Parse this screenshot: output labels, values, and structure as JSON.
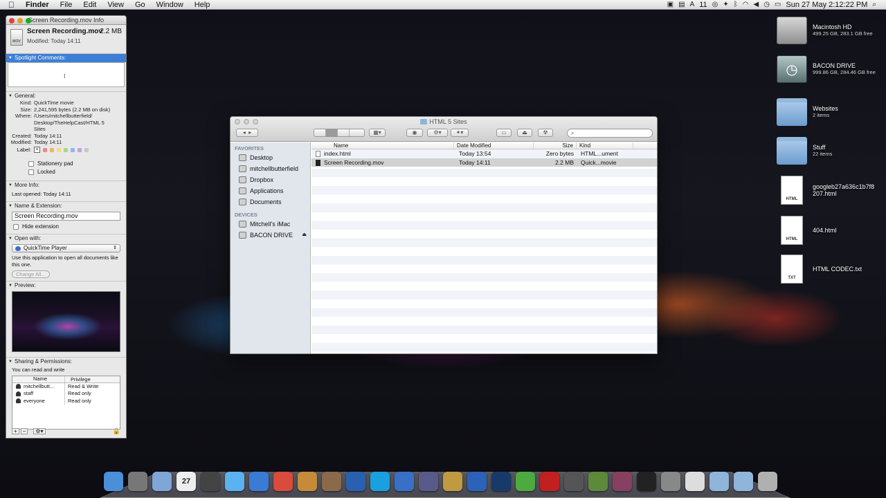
{
  "menubar": {
    "app": "Finder",
    "items": [
      "File",
      "Edit",
      "View",
      "Go",
      "Window",
      "Help"
    ],
    "status": "11",
    "clock": "Sun 27 May  2:12:22 PM"
  },
  "info": {
    "title": "Screen Recording.mov Info",
    "file_name": "Screen Recording.mov",
    "file_size": "2.2 MB",
    "modified": "Modified: Today 14:11",
    "file_icon_label": "MOV",
    "spotlight": "Spotlight Comments:",
    "general": "General:",
    "kind_k": "Kind:",
    "kind_v": "QuickTime movie",
    "size_k": "Size:",
    "size_v": "2,241,595 bytes (2.2 MB on disk)",
    "where_k": "Where:",
    "where_v1": "/Users/mitchellbutterfield/",
    "where_v2": "Desktop/TheHelpCast/HTML 5",
    "where_v3": "Sites",
    "created_k": "Created:",
    "created_v": "Today 14:11",
    "modified_k": "Modified:",
    "modified_v": "Today 14:11",
    "label_k": "Label:",
    "stationery": "Stationery pad",
    "locked": "Locked",
    "more_info": "More Info:",
    "last_opened": "Last opened: Today 14:11",
    "name_ext": "Name & Extension:",
    "name_value": "Screen Recording.mov",
    "hide_ext": "Hide extension",
    "open_with": "Open with:",
    "app_value": "QuickTime Player",
    "use_app": "Use this application to open all documents like this one.",
    "change_all": "Change All...",
    "preview": "Preview:",
    "sharing": "Sharing & Permissions:",
    "can_rw": "You can read and write",
    "perm_head_name": "Name",
    "perm_head_priv": "Privilege",
    "perms": [
      {
        "name": "mitchellbutt...",
        "priv": "Read & Write"
      },
      {
        "name": "staff",
        "priv": "Read only"
      },
      {
        "name": "everyone",
        "priv": "Read only"
      }
    ],
    "label_colors": [
      "#e98b8b",
      "#f2b36b",
      "#f0e07a",
      "#a7d98c",
      "#8cb8ef",
      "#c3a2e0",
      "#c8c8c8"
    ]
  },
  "finder": {
    "title": "HTML 5 Sites",
    "sections": {
      "favorites": "FAVORITES",
      "devices": "DEVICES"
    },
    "favorites": [
      "Desktop",
      "mitchellbutterfield",
      "Dropbox",
      "Applications",
      "Documents"
    ],
    "devices": [
      "Mitchell's iMac",
      "BACON DRIVE"
    ],
    "columns": {
      "name": "Name",
      "date": "Date Modified",
      "size": "Size",
      "kind": "Kind"
    },
    "rows": [
      {
        "name": "index.html",
        "date": "Today 13:54",
        "size": "Zero bytes",
        "kind": "HTML...ument"
      },
      {
        "name": "Screen Recording.mov",
        "date": "Today 14:11",
        "size": "2.2 MB",
        "kind": "Quick...movie"
      }
    ]
  },
  "desktop": [
    {
      "name": "Macintosh HD",
      "sub": "499.25 GB, 283.1 GB free"
    },
    {
      "name": "BACON DRIVE",
      "sub": "999.86 GB, 284.46 GB free"
    },
    {
      "name": "Websites",
      "sub": "2 items"
    },
    {
      "name": "Stuff",
      "sub": "22 items"
    },
    {
      "name": "googleb27a636c1b7f8207.html",
      "line1": "googleb27a636c1b7f8",
      "line2": "207.html",
      "badge": "HTML"
    },
    {
      "name": "404.html",
      "badge": "HTML"
    },
    {
      "name": "HTML CODEC.txt",
      "badge": "TXT"
    }
  ],
  "dock": {
    "items": [
      {
        "name": "finder",
        "color": "#4a8fd8"
      },
      {
        "name": "launchpad",
        "color": "#777"
      },
      {
        "name": "preview",
        "color": "#7fa6d6"
      },
      {
        "name": "calendar",
        "color": "#eee",
        "text": "27"
      },
      {
        "name": "facetime",
        "color": "#444"
      },
      {
        "name": "messages",
        "color": "#5ab2f0"
      },
      {
        "name": "itunes",
        "color": "#3a7bd5"
      },
      {
        "name": "chrome",
        "color": "#d94b3b"
      },
      {
        "name": "garageband",
        "color": "#c58b3a"
      },
      {
        "name": "iphoto",
        "color": "#8a6a4a"
      },
      {
        "name": "globe",
        "color": "#2a60b0"
      },
      {
        "name": "skype",
        "color": "#1aa0e0"
      },
      {
        "name": "quicktime",
        "color": "#3870c8"
      },
      {
        "name": "imovie",
        "color": "#5a5a8a"
      },
      {
        "name": "app",
        "color": "#c09a40"
      },
      {
        "name": "word",
        "color": "#2c62b8"
      },
      {
        "name": "photoshop",
        "color": "#183a6a"
      },
      {
        "name": "leaf",
        "color": "#4caa40"
      },
      {
        "name": "filezilla",
        "color": "#c02020"
      },
      {
        "name": "steam",
        "color": "#555"
      },
      {
        "name": "minecraft",
        "color": "#5c8a3a"
      },
      {
        "name": "brush",
        "color": "#884060"
      },
      {
        "name": "terminal",
        "color": "#222"
      },
      {
        "name": "system-preferences",
        "color": "#888"
      },
      {
        "name": "notes",
        "color": "#ddd"
      },
      {
        "name": "applications-stack",
        "color": "#8fb5da"
      },
      {
        "name": "documents-stack",
        "color": "#8fb5da"
      },
      {
        "name": "trash",
        "color": "#b0b0b0"
      }
    ]
  }
}
